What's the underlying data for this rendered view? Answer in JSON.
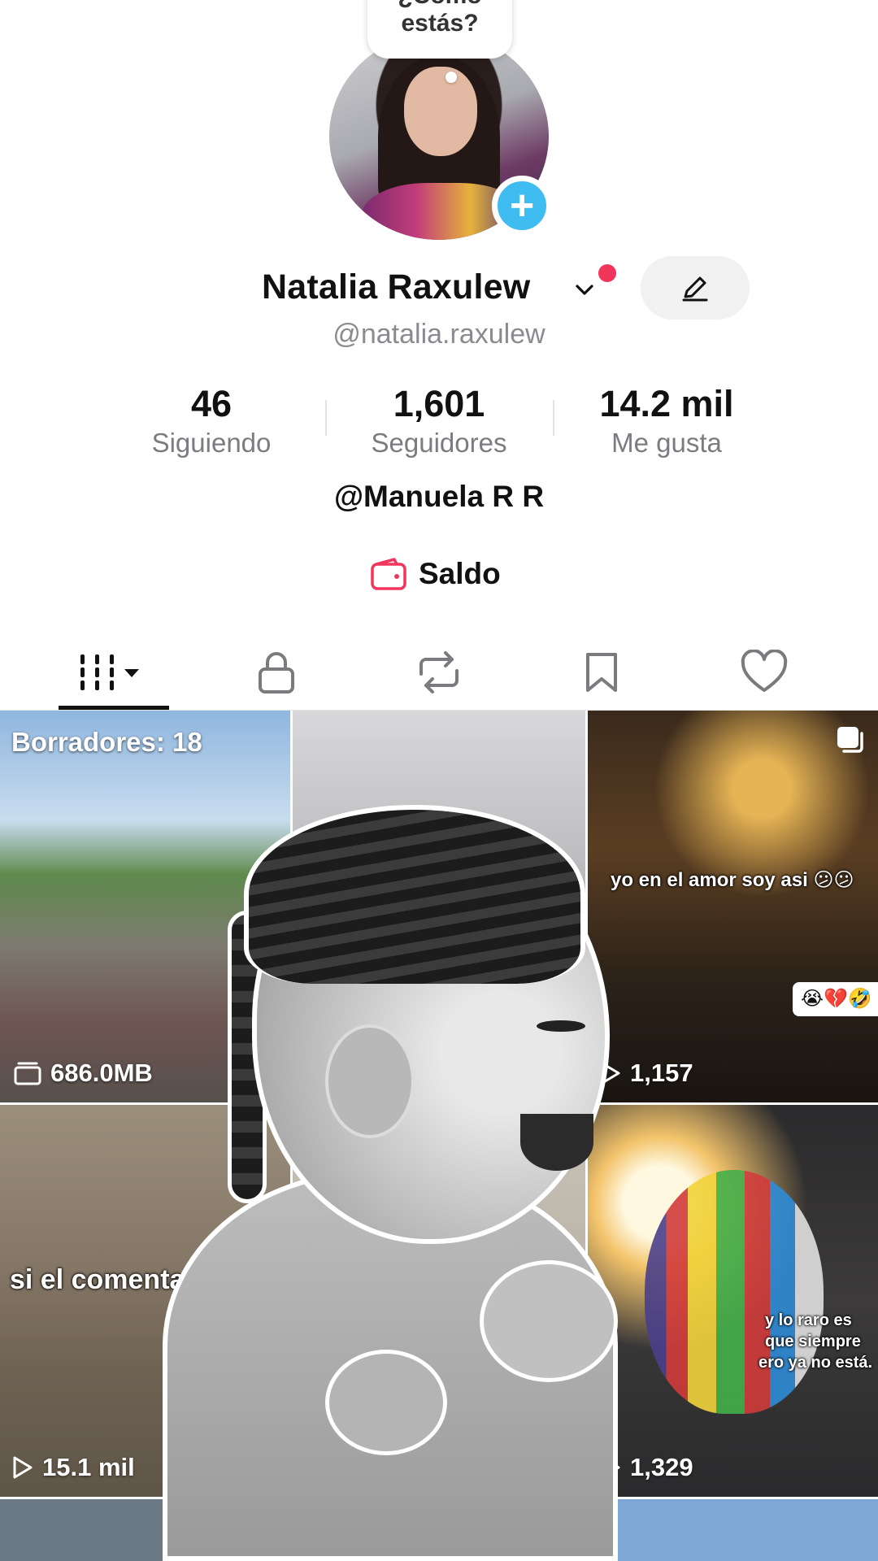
{
  "profile": {
    "status_bubble": "¿Cómo estás?",
    "status_bubble_line1": "¿Cómo",
    "status_bubble_line2": "estás?",
    "name": "Natalia Raxulew",
    "handle": "@natalia.raxulew",
    "bio": "@Manuela R R",
    "balance_label": "Saldo"
  },
  "stats": [
    {
      "value": "46",
      "label": "Siguiendo"
    },
    {
      "value": "1,601",
      "label": "Seguidores"
    },
    {
      "value": "14.2 mil",
      "label": "Me gusta"
    }
  ],
  "tabs": [
    {
      "icon": "grid-icon",
      "selected": true
    },
    {
      "icon": "lock-icon",
      "selected": false
    },
    {
      "icon": "repost-icon",
      "selected": false
    },
    {
      "icon": "bookmark-icon",
      "selected": false
    },
    {
      "icon": "heart-icon",
      "selected": false
    }
  ],
  "grid": {
    "drafts_label": "Borradores: 18",
    "drafts_size": "686.0MB",
    "c3_caption": "yo en el amor soy asi 😕😕",
    "c3_emojis": "😭💔🤣",
    "c3_views": "1,157",
    "c4_caption": "si el comenta",
    "c4_views": "15.1 mil",
    "c6_caption_1": "y lo raro es",
    "c6_caption_2": "que siempre",
    "c6_caption_3": "ero ya no está.",
    "c6_views": "1,329"
  },
  "colors": {
    "accent_blue": "#3fbcf0",
    "notification_red": "#f2355a",
    "wallet_red": "#f2355a"
  }
}
